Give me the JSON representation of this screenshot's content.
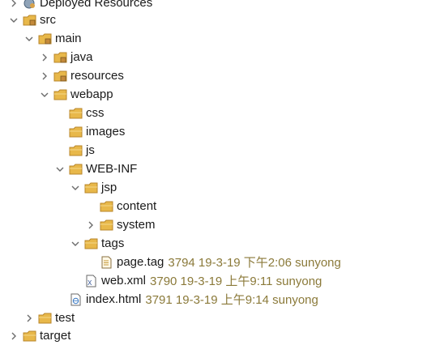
{
  "tree": {
    "deployed": {
      "label": "Deployed Resources"
    },
    "src": {
      "label": "src"
    },
    "main": {
      "label": "main"
    },
    "java": {
      "label": "java"
    },
    "resources": {
      "label": "resources"
    },
    "webapp": {
      "label": "webapp"
    },
    "css": {
      "label": "css"
    },
    "images": {
      "label": "images"
    },
    "js": {
      "label": "js"
    },
    "webinf": {
      "label": "WEB-INF"
    },
    "jsp": {
      "label": "jsp"
    },
    "content": {
      "label": "content"
    },
    "system": {
      "label": "system"
    },
    "tags": {
      "label": "tags"
    },
    "pagetag": {
      "label": "page.tag",
      "decoration": "3794  19-3-19 下午2:06  sunyong"
    },
    "webxml": {
      "label": "web.xml",
      "decoration": "3790  19-3-19 上午9:11  sunyong"
    },
    "indexhtml": {
      "label": "index.html",
      "decoration": "3791  19-3-19 上午9:14  sunyong"
    },
    "test": {
      "label": "test"
    },
    "target": {
      "label": "target"
    }
  },
  "colors": {
    "folder": "#e8b84a",
    "folder_dark": "#b8862a",
    "decoration": "#8b7a3a",
    "twisty": "#6b6b6b"
  },
  "icons": {
    "expanded": "chevron-down-icon",
    "collapsed": "chevron-right-icon",
    "folder": "folder-icon",
    "package_folder": "package-folder-icon",
    "tag_file": "tag-file-icon",
    "xml_file": "xml-file-icon",
    "html_file": "html-file-icon"
  }
}
